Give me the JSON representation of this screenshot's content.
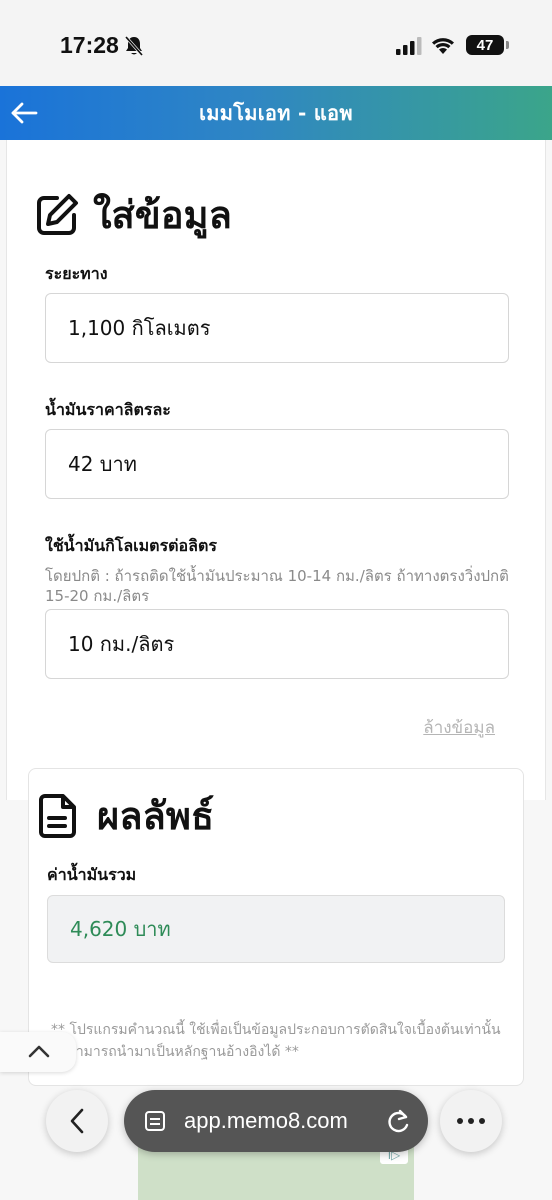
{
  "status_bar": {
    "time": "17:28",
    "battery": "47"
  },
  "header": {
    "title": "เมมโมเอท - แอพ"
  },
  "form": {
    "heading": "ใส่ข้อมูล",
    "distance": {
      "label": "ระยะทาง",
      "value": "1,100 กิโลเมตร"
    },
    "fuel_price": {
      "label": "น้ำมันราคาลิตรละ",
      "value": "42 บาท"
    },
    "consumption": {
      "label": "ใช้น้ำมันกิโลเมตรต่อลิตร",
      "hint": "โดยปกติ : ถ้ารถติดใช้น้ำมันประมาณ 10-14 กม./ลิตร ถ้าทางตรงวิ่งปกติ 15-20 กม./ลิตร",
      "value": "10 กม./ลิตร"
    },
    "clear_label": "ล้างข้อมูล"
  },
  "result": {
    "heading": "ผลลัพธ์",
    "total_label": "ค่าน้ำมันรวม",
    "total_value": "4,620 บาท",
    "disclaimer": "** โปรแกรมคำนวณนี้ ใช้เพื่อเป็นข้อมูลประกอบการตัดสินใจเบื้องต้นเท่านั้น ไม่สามารถนำมาเป็นหลักฐานอ้างอิงได้ **"
  },
  "browser": {
    "url": "app.memo8.com"
  },
  "colors": {
    "header_gradient_start": "#1a73d9",
    "header_gradient_end": "#3ba58a",
    "result_value": "#2e8b57"
  }
}
